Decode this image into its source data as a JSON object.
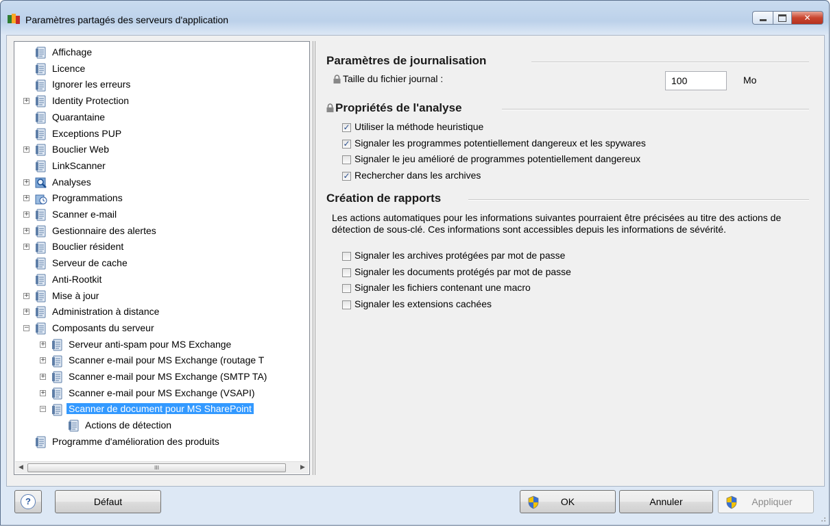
{
  "window": {
    "title": "Paramètres partagés des serveurs d'application"
  },
  "tree": {
    "items": [
      {
        "label": "Affichage",
        "level": 0,
        "expander": "none",
        "icon": "settings-page-icon"
      },
      {
        "label": "Licence",
        "level": 0,
        "expander": "none",
        "icon": "settings-page-icon"
      },
      {
        "label": "Ignorer les erreurs",
        "level": 0,
        "expander": "none",
        "icon": "settings-page-icon"
      },
      {
        "label": "Identity Protection",
        "level": 0,
        "expander": "plus",
        "icon": "settings-page-icon"
      },
      {
        "label": "Quarantaine",
        "level": 0,
        "expander": "none",
        "icon": "settings-page-icon"
      },
      {
        "label": "Exceptions PUP",
        "level": 0,
        "expander": "none",
        "icon": "settings-page-icon"
      },
      {
        "label": "Bouclier Web",
        "level": 0,
        "expander": "plus",
        "icon": "settings-page-icon"
      },
      {
        "label": "LinkScanner",
        "level": 0,
        "expander": "none",
        "icon": "settings-page-icon"
      },
      {
        "label": "Analyses",
        "level": 0,
        "expander": "plus",
        "icon": "magnifier-icon"
      },
      {
        "label": "Programmations",
        "level": 0,
        "expander": "plus",
        "icon": "clock-icon"
      },
      {
        "label": "Scanner e-mail",
        "level": 0,
        "expander": "plus",
        "icon": "settings-page-icon"
      },
      {
        "label": "Gestionnaire des alertes",
        "level": 0,
        "expander": "plus",
        "icon": "settings-page-icon"
      },
      {
        "label": "Bouclier résident",
        "level": 0,
        "expander": "plus",
        "icon": "settings-page-icon"
      },
      {
        "label": "Serveur de cache",
        "level": 0,
        "expander": "none",
        "icon": "settings-page-icon"
      },
      {
        "label": "Anti-Rootkit",
        "level": 0,
        "expander": "none",
        "icon": "settings-page-icon"
      },
      {
        "label": "Mise à jour",
        "level": 0,
        "expander": "plus",
        "icon": "settings-page-icon"
      },
      {
        "label": "Administration à distance",
        "level": 0,
        "expander": "plus",
        "icon": "settings-page-icon"
      },
      {
        "label": "Composants du serveur",
        "level": 0,
        "expander": "minus",
        "icon": "settings-page-icon"
      },
      {
        "label": "Serveur anti-spam pour MS Exchange",
        "level": 1,
        "expander": "plus",
        "icon": "settings-page-icon"
      },
      {
        "label": "Scanner e-mail pour MS Exchange (routage T",
        "level": 1,
        "expander": "plus",
        "icon": "settings-page-icon"
      },
      {
        "label": "Scanner e-mail pour MS Exchange (SMTP TA)",
        "level": 1,
        "expander": "plus",
        "icon": "settings-page-icon"
      },
      {
        "label": "Scanner e-mail pour MS Exchange (VSAPI)",
        "level": 1,
        "expander": "plus",
        "icon": "settings-page-icon"
      },
      {
        "label": "Scanner de document pour MS SharePoint",
        "level": 1,
        "expander": "minus",
        "icon": "settings-page-icon",
        "selected": true
      },
      {
        "label": "Actions de détection",
        "level": 2,
        "expander": "none",
        "icon": "settings-page-icon"
      },
      {
        "label": "Programme d'amélioration des produits",
        "level": 0,
        "expander": "none",
        "icon": "settings-page-icon"
      }
    ],
    "scrollbar_thumb_glyph": "III"
  },
  "logging": {
    "title": "Paramètres de journalisation",
    "size_label": "Taille du fichier journal :",
    "size_value": "100",
    "size_unit": "Mo"
  },
  "analysis": {
    "title": "Propriétés de l'analyse",
    "options": [
      {
        "label": "Utiliser la méthode heuristique",
        "checked": true
      },
      {
        "label": "Signaler les programmes potentiellement dangereux et les spywares",
        "checked": true
      },
      {
        "label": "Signaler le jeu amélioré de programmes potentiellement dangereux",
        "checked": false
      },
      {
        "label": "Rechercher dans les archives",
        "checked": true
      }
    ]
  },
  "reports": {
    "title": "Création de rapports",
    "description": "Les actions automatiques pour les informations suivantes pourraient être précisées au titre des actions de détection de sous-clé. Ces informations sont accessibles depuis les informations de sévérité.",
    "options": [
      {
        "label": "Signaler les archives protégées par mot de passe",
        "checked": false
      },
      {
        "label": "Signaler les documents protégés par mot de passe",
        "checked": false
      },
      {
        "label": "Signaler les fichiers contenant une macro",
        "checked": false
      },
      {
        "label": "Signaler les extensions cachées",
        "checked": false
      }
    ]
  },
  "buttons": {
    "help": "?",
    "default": "Défaut",
    "ok": "OK",
    "cancel": "Annuler",
    "apply": "Appliquer"
  },
  "colors": {
    "selection": "#3399ff",
    "close_button": "#c9452f"
  }
}
